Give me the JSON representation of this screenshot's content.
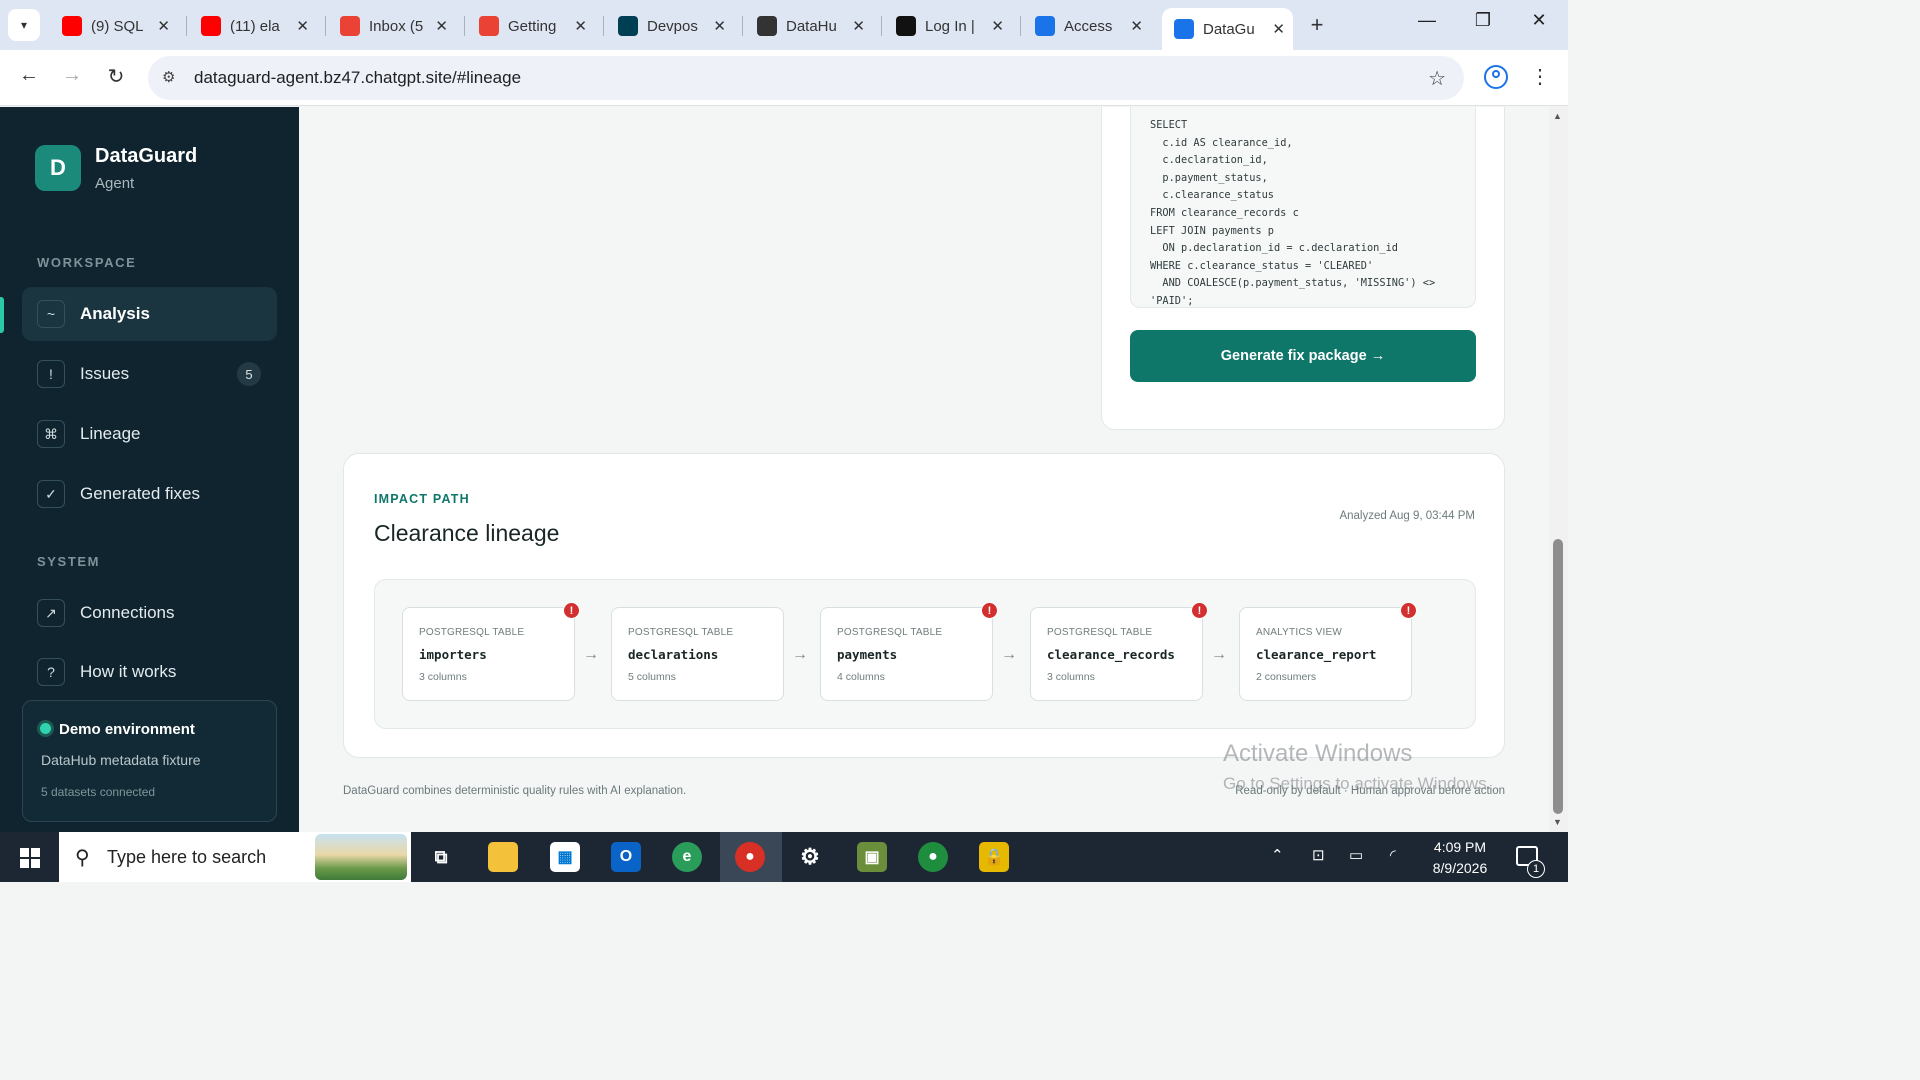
{
  "browser": {
    "tabs": [
      {
        "label": "(9) SQL",
        "favicon": "youtube-icon",
        "color": "#ff0000"
      },
      {
        "label": "(11) ela",
        "favicon": "youtube-icon",
        "color": "#ff0000"
      },
      {
        "label": "Inbox (5",
        "favicon": "gmail-icon",
        "color": "#ea4335"
      },
      {
        "label": "Getting",
        "favicon": "gmail-icon",
        "color": "#ea4335"
      },
      {
        "label": "Devpos",
        "favicon": "devpost-icon",
        "color": "#003e54"
      },
      {
        "label": "DataHu",
        "favicon": "openai-icon",
        "color": "#333333"
      },
      {
        "label": "Log In |",
        "favicon": "bars-icon",
        "color": "#111111"
      },
      {
        "label": "Access",
        "favicon": "grid-app-icon",
        "color": "#1a73e8"
      },
      {
        "label": "DataGu",
        "favicon": "grid-app-icon",
        "color": "#1a73e8",
        "active": true
      }
    ],
    "url": "dataguard-agent.bz47.chatgpt.site/#lineage"
  },
  "sidebar": {
    "logo_letter": "D",
    "brand": "DataGuard",
    "brand_sub": "Agent",
    "workspace_label": "WORKSPACE",
    "workspace_items": [
      {
        "label": "Analysis",
        "icon": "~",
        "active": true
      },
      {
        "label": "Issues",
        "icon": "!",
        "badge": "5"
      },
      {
        "label": "Lineage",
        "icon": "⌘"
      },
      {
        "label": "Generated fixes",
        "icon": "✓"
      }
    ],
    "system_label": "SYSTEM",
    "system_items": [
      {
        "label": "Connections",
        "icon": "↗"
      },
      {
        "label": "How it works",
        "icon": "?"
      }
    ],
    "demo": {
      "title": "Demo environment",
      "subtitle": "DataHub metadata fixture",
      "meta": "5 datasets connected"
    }
  },
  "fix": {
    "sql": "SELECT\n  c.id AS clearance_id,\n  c.declaration_id,\n  p.payment_status,\n  c.clearance_status\nFROM clearance_records c\nLEFT JOIN payments p\n  ON p.declaration_id = c.declaration_id\nWHERE c.clearance_status = 'CLEARED'\n  AND COALESCE(p.payment_status, 'MISSING') <>\n'PAID';",
    "button_label": "Generate fix package  →"
  },
  "impact": {
    "eyebrow": "IMPACT PATH",
    "title": "Clearance lineage",
    "analyzed": "Analyzed Aug 9, 03:44 PM",
    "nodes": [
      {
        "type": "POSTGRESQL TABLE",
        "name": "importers",
        "meta": "3 columns",
        "alert": true
      },
      {
        "type": "POSTGRESQL TABLE",
        "name": "declarations",
        "meta": "5 columns",
        "alert": false
      },
      {
        "type": "POSTGRESQL TABLE",
        "name": "payments",
        "meta": "4 columns",
        "alert": true
      },
      {
        "type": "POSTGRESQL TABLE",
        "name": "clearance_records",
        "meta": "3 columns",
        "alert": true
      },
      {
        "type": "ANALYTICS VIEW",
        "name": "clearance_report",
        "meta": "2 consumers",
        "alert": true
      }
    ]
  },
  "footer": {
    "left": "DataGuard combines deterministic quality rules with AI explanation.",
    "right": "Read-only by default · Human approval before action"
  },
  "watermark": {
    "line1": "Activate Windows",
    "line2": "Go to Settings to activate Windows."
  },
  "taskbar": {
    "search_placeholder": "Type here to search",
    "time": "4:09 PM",
    "date": "8/9/2026",
    "notifications": "1"
  },
  "colors": {
    "sidebar_bg": "#10242f",
    "accent": "#0f766a",
    "alert": "#d32f2f"
  }
}
